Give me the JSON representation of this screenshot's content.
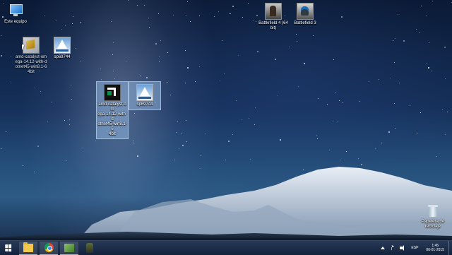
{
  "desktop_icons": {
    "computer": {
      "label": "Este equipo",
      "icon": "computer-icon"
    },
    "amd_installer_top": {
      "label": "amd-catalyst-om\nega-14.12-with-d\notnet45-win8.1-6\n4bit",
      "icon": "installer-package-icon"
    },
    "sp_top": {
      "label": "sp69744",
      "icon": "setup-sailboat-icon"
    },
    "amd_installer_selected": {
      "label": "amd-catalyst-om\nega-14.12-with-d\notnet45-win8.1-6\n4bit",
      "icon": "amd-logo-icon"
    },
    "sp_selected": {
      "label": "sp69744",
      "icon": "setup-sailboat-icon"
    },
    "bf4": {
      "label": "Battlefield 4 (64\nbit)",
      "icon": "battlefield-4-icon"
    },
    "bf3": {
      "label": "Battlefield 3",
      "icon": "battlefield-3-icon"
    },
    "recycle_bin": {
      "label": "Papelera de\nreciclaje",
      "icon": "recycle-bin-icon"
    }
  },
  "taskbar": {
    "start_icon": "windows-logo-icon",
    "buttons": [
      {
        "name": "file-explorer",
        "icon": "folder-icon"
      },
      {
        "name": "chrome",
        "icon": "chrome-icon"
      },
      {
        "name": "installer",
        "icon": "installer-icon"
      },
      {
        "name": "battlefield",
        "icon": "soldier-icon"
      }
    ],
    "tray": {
      "language": "ESP",
      "time": "1:45",
      "date": "06-01-2015"
    }
  },
  "colors": {
    "taskbar": "#1f324f",
    "selection": "#a0c8f0"
  }
}
